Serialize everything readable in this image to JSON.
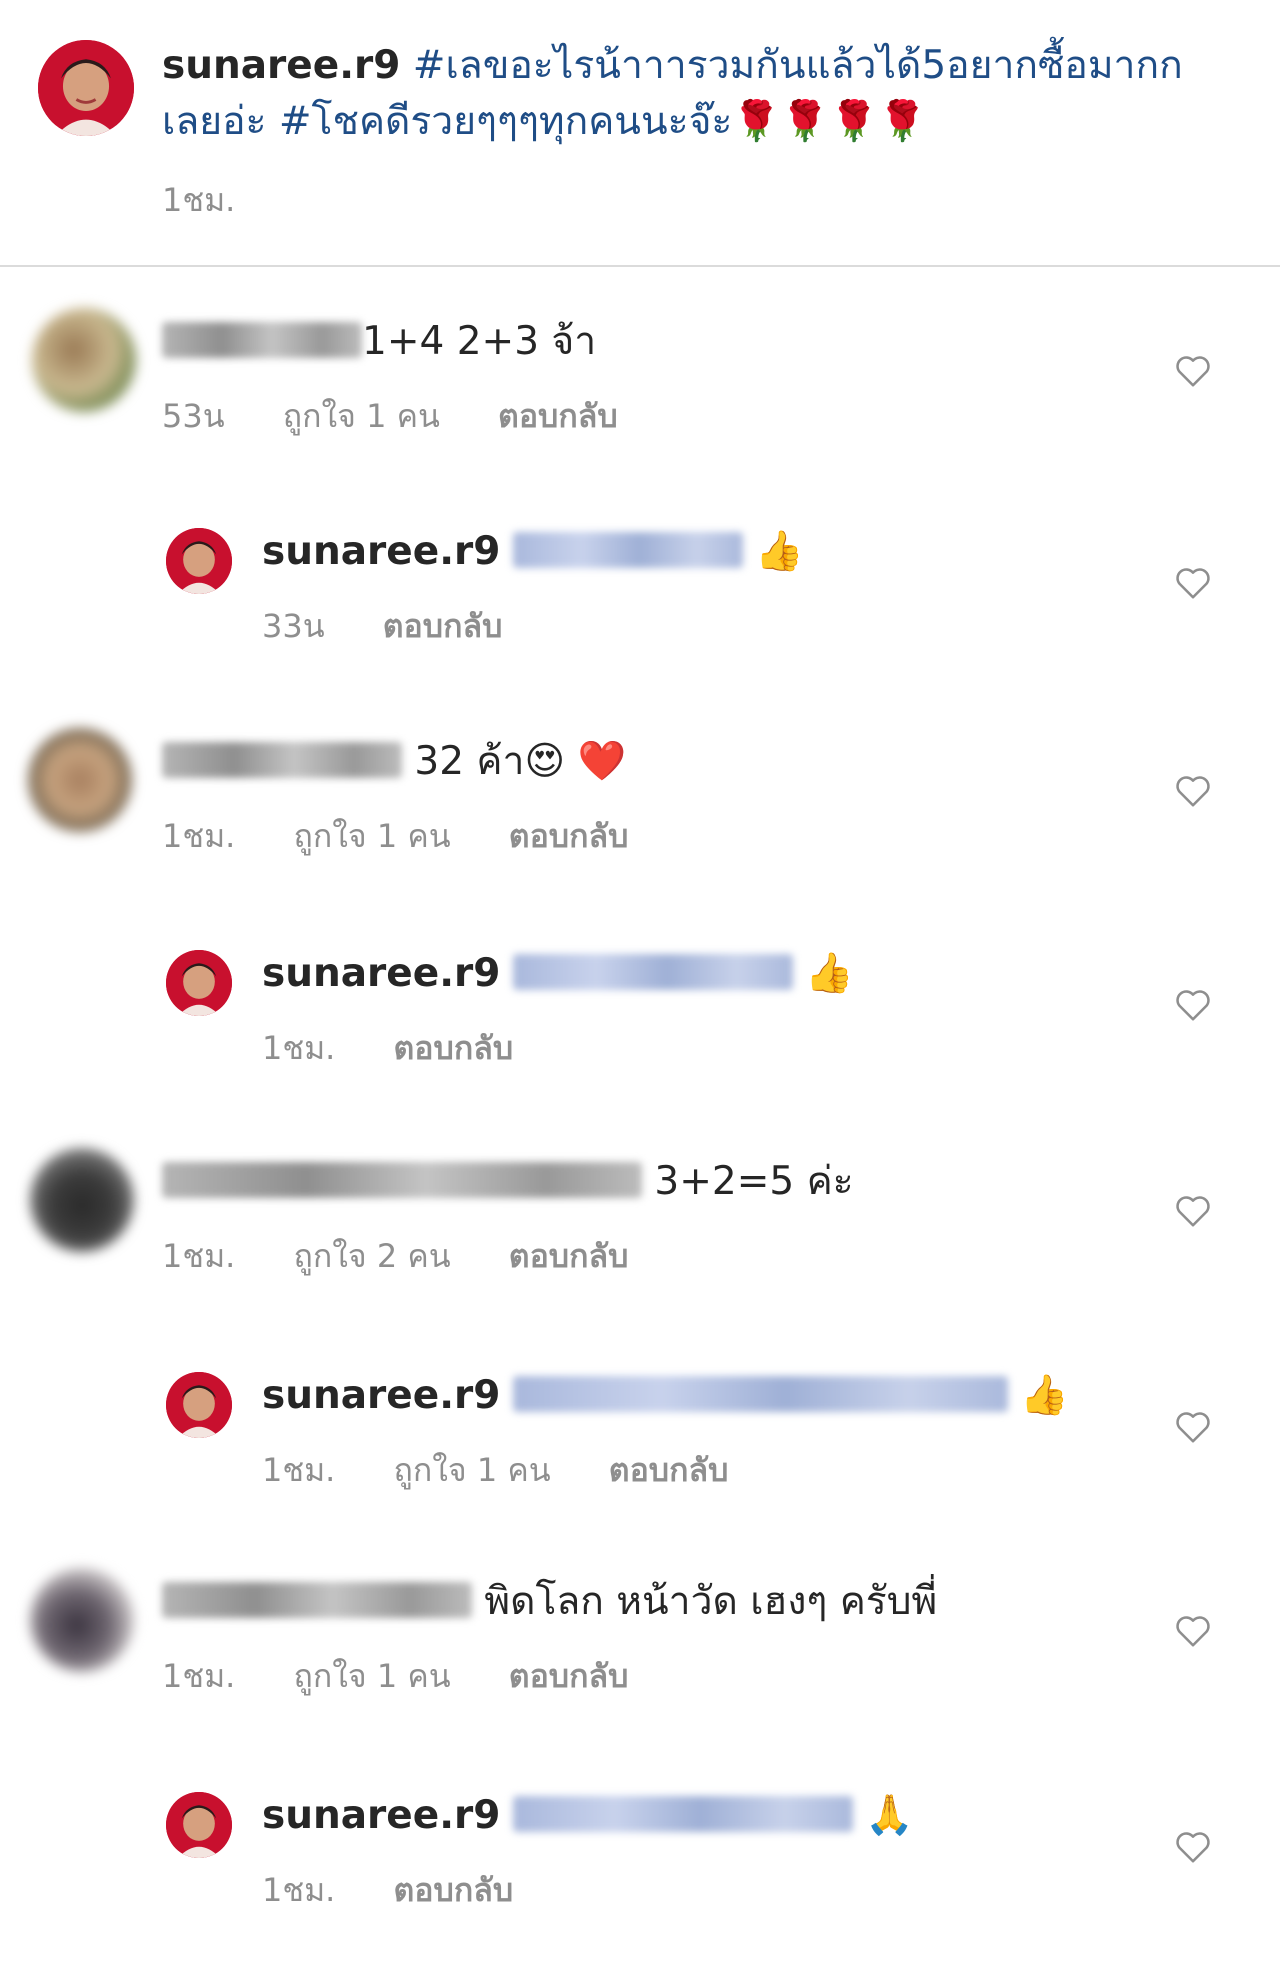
{
  "caption": {
    "username": "sunaree.r9",
    "text": "#เลขอะไรน้าาารวมกันแล้วได้5อยากซื้อมากกเลยอ่ะ #โชคดีรวยๆๆๆทุกคนนะจ๊ะ🌹🌹🌹🌹",
    "time": "1ชม."
  },
  "comments": [
    {
      "text": "1+4 2+3 จ้า",
      "time": "53น",
      "likes": "ถูกใจ 1 คน",
      "reply": "ตอบกลับ",
      "emoji": ""
    },
    {
      "username": "sunaree.r9",
      "emoji": "👍",
      "time": "33น",
      "likes": "",
      "reply": "ตอบกลับ"
    },
    {
      "text": "32 ค้า",
      "emoji": "😍 ❤️",
      "time": "1ชม.",
      "likes": "ถูกใจ 1 คน",
      "reply": "ตอบกลับ"
    },
    {
      "username": "sunaree.r9",
      "emoji": "👍",
      "time": "1ชม.",
      "likes": "",
      "reply": "ตอบกลับ"
    },
    {
      "text": "3+2=5 ค่ะ",
      "emoji": "",
      "time": "1ชม.",
      "likes": "ถูกใจ 2 คน",
      "reply": "ตอบกลับ"
    },
    {
      "username": "sunaree.r9",
      "emoji": "👍",
      "time": "1ชม.",
      "likes": "ถูกใจ 1 คน",
      "reply": "ตอบกลับ"
    },
    {
      "text": "พิดโลก หน้าวัด เฮงๆ ครับพี่",
      "emoji": "",
      "time": "1ชม.",
      "likes": "ถูกใจ 1 คน",
      "reply": "ตอบกลับ"
    },
    {
      "username": "sunaree.r9",
      "emoji": "🙏",
      "time": "1ชม.",
      "likes": "",
      "reply": "ตอบกลับ"
    }
  ],
  "icons": {
    "like": "heart-outline-icon"
  },
  "colors": {
    "hashtag": "#1f4d86",
    "secondary_text": "#8e8e8e",
    "divider": "#dbdbdb"
  }
}
